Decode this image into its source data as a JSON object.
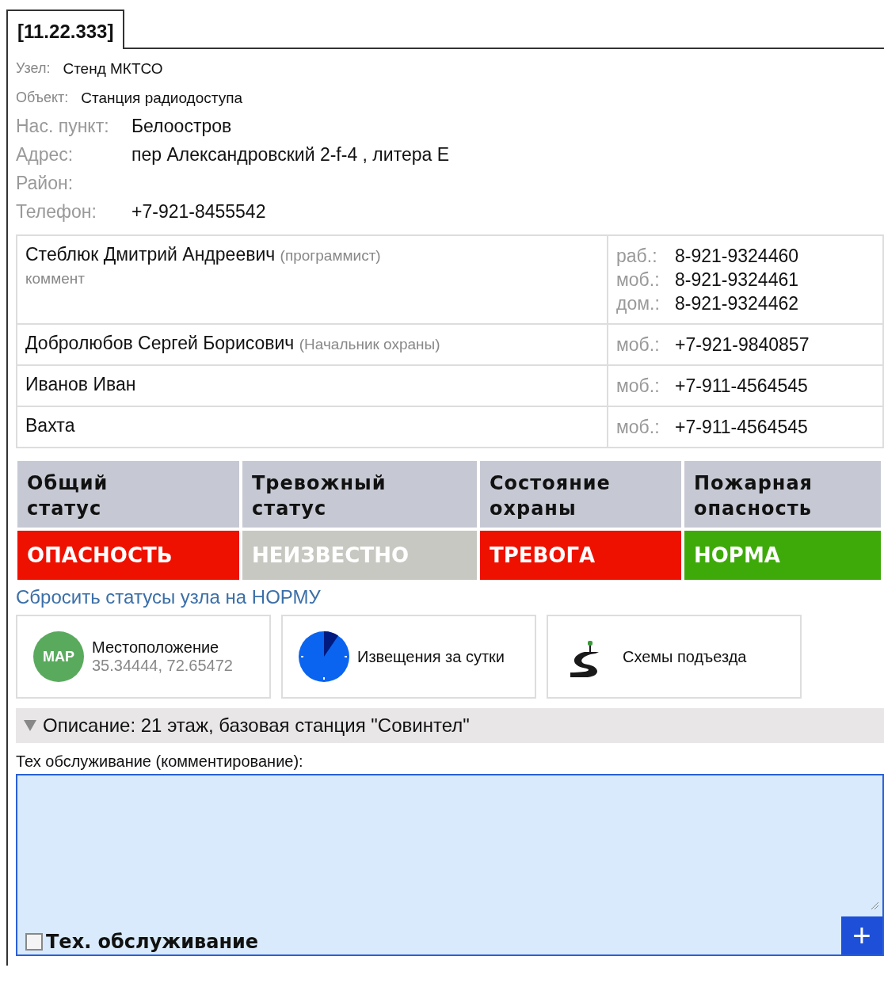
{
  "tab": {
    "label": "[11.22.333]",
    "selected": true
  },
  "small_fields": [
    {
      "label": "Узел:",
      "value": "Стенд МКТСО"
    },
    {
      "label": "Объект:",
      "value": "Станция радиодоступа"
    }
  ],
  "fields": [
    {
      "label": "Нас. пункт:",
      "value": "Белоостров"
    },
    {
      "label": "Адрес:",
      "value": "пер Александровский 2-f-4  , литера Е"
    },
    {
      "label": "Район:"
    },
    {
      "label": "Телефон:",
      "value": "+7-921-8455542"
    }
  ],
  "contacts": [
    {
      "name": "Стеблюк Дмитрий Андреевич",
      "role": "(программист)",
      "comment": "коммент",
      "phones": [
        {
          "type": "раб.:",
          "number": "8-921-9324460"
        },
        {
          "type": "моб.:",
          "number": "8-921-9324461"
        },
        {
          "type": "дом.:",
          "number": "8-921-9324462"
        }
      ]
    },
    {
      "name": "Добролюбов Сергей Борисович",
      "role": "(Начальник охраны)",
      "phones": [
        {
          "type": "моб.:",
          "number": "+7-921-9840857"
        }
      ]
    },
    {
      "name": "Иванов Иван",
      "phones": [
        {
          "type": "моб.:",
          "number": "+7-911-4564545"
        }
      ]
    },
    {
      "name": "Вахта",
      "phones": [
        {
          "type": "моб.:",
          "number": "+7-911-4564545"
        }
      ]
    }
  ],
  "statuses": [
    {
      "title": "Общий\nстатус",
      "value": "ОПАСНОСТЬ",
      "color": "#ee1100"
    },
    {
      "title": "Тревожный статус",
      "value": "НЕИЗВЕСТНО",
      "color": "#c8c8c2"
    },
    {
      "title": "Состояние охраны",
      "value": "ТРЕВОГА",
      "color": "#ee1100"
    },
    {
      "title": "Пожарная опасность",
      "value": "НОРМА",
      "color": "#3eaa0a"
    }
  ],
  "reset_link": "Сбросить статусы узла на НОРМУ",
  "cards": [
    {
      "kind": "map",
      "badge": "MAP",
      "title": "Местоположение",
      "subtitle": "35.34444, 72.65472"
    },
    {
      "kind": "clock",
      "title": "Извещения за сутки"
    },
    {
      "kind": "road",
      "title": "Схемы подъезда"
    }
  ],
  "description": {
    "text": "Описание: 21 этаж, базовая станция \"Совинтел\"",
    "expanded": true
  },
  "maintenance": {
    "label": "Тех обслуживание (комментирование):",
    "checkbox_label": "Тех. обслуживание",
    "checked": false,
    "add_button": "+"
  }
}
